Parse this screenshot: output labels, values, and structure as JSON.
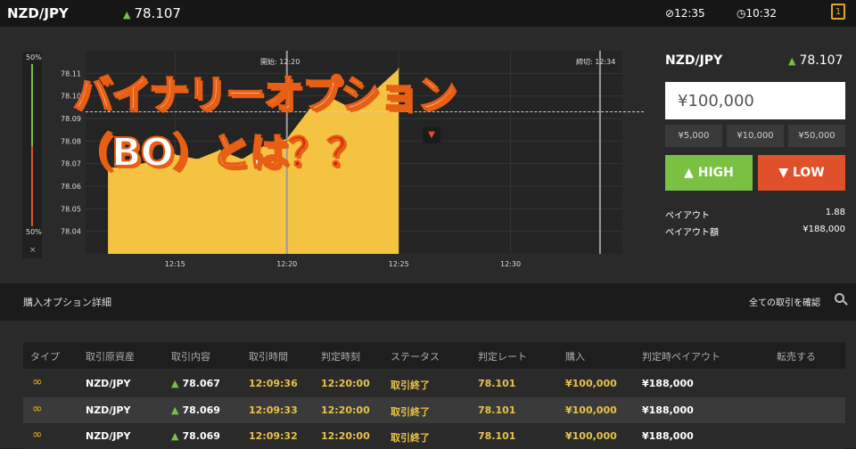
{
  "header": {
    "pair": "NZD/JPY",
    "rate": "78.107",
    "time_remaining": "12:35",
    "time_current": "10:32",
    "icon": "bell-icon"
  },
  "chart": {
    "gauge_top": "50%",
    "gauge_bottom": "50%",
    "gauge_close": "×",
    "start_label": "開始: 12:20",
    "end_label": "締切: 12:34",
    "overlay_line1": "バイナリーオプション",
    "overlay_line2": "（BO）とは",
    "overlay_q": "？？"
  },
  "chart_data": {
    "type": "area",
    "x_ticks": [
      "12:15",
      "12:20",
      "12:25",
      "12:30"
    ],
    "y_ticks": [
      "78.11",
      "78.10",
      "78.09",
      "78.08",
      "78.07",
      "78.06",
      "78.05",
      "78.04"
    ],
    "x": [
      "12:12",
      "12:13",
      "12:14",
      "12:15",
      "12:16",
      "12:17",
      "12:18",
      "12:19",
      "12:20",
      "12:21",
      "12:22",
      "12:23",
      "12:24",
      "12:25"
    ],
    "values": [
      78.068,
      78.069,
      78.071,
      78.074,
      78.072,
      78.076,
      78.072,
      78.078,
      78.081,
      78.094,
      78.099,
      78.094,
      78.103,
      78.112
    ],
    "ylim": [
      78.03,
      78.12
    ],
    "grid": true
  },
  "trade_panel": {
    "pair": "NZD/JPY",
    "rate": "78.107",
    "amount": "¥100,000",
    "quick_amounts": [
      "¥5,000",
      "¥10,000",
      "¥50,000"
    ],
    "high_label": "HIGH",
    "low_label": "LOW",
    "payout_label": "ペイアウト",
    "payout_value": "1.88",
    "payout_amount_label": "ペイアウト額",
    "payout_amount_value": "¥188,000"
  },
  "section": {
    "title": "購入オプション詳細",
    "view_all": "全ての取引を確認"
  },
  "table": {
    "headers": [
      "タイプ",
      "取引原資産",
      "取引内容",
      "取引時間",
      "判定時刻",
      "ステータス",
      "判定レート",
      "購入",
      "判定時ペイアウト",
      "転売する"
    ],
    "rows": [
      {
        "asset": "NZD/JPY",
        "content": "78.067",
        "time": "12:09:36",
        "judge": "12:20:00",
        "status": "取引終了",
        "rate": "78.101",
        "buy": "¥100,000",
        "payout": "¥188,000"
      },
      {
        "asset": "NZD/JPY",
        "content": "78.069",
        "time": "12:09:33",
        "judge": "12:20:00",
        "status": "取引終了",
        "rate": "78.101",
        "buy": "¥100,000",
        "payout": "¥188,000"
      },
      {
        "asset": "NZD/JPY",
        "content": "78.069",
        "time": "12:09:32",
        "judge": "12:20:00",
        "status": "取引終了",
        "rate": "78.101",
        "buy": "¥100,000",
        "payout": "¥188,000"
      }
    ]
  }
}
